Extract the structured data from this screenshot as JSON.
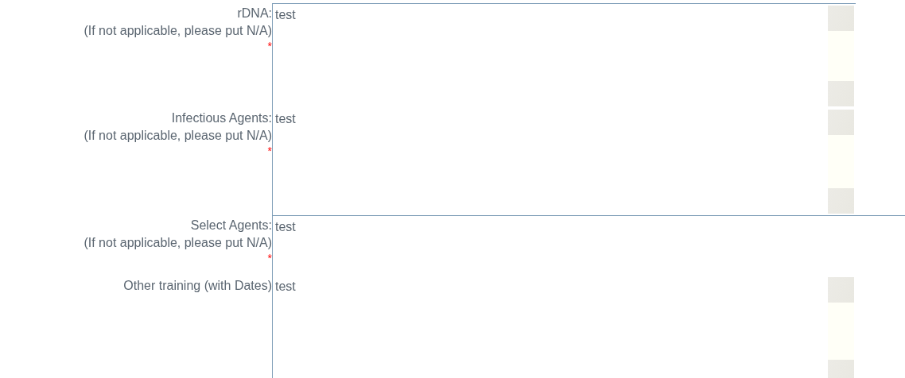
{
  "fields": [
    {
      "label": "rDNA:",
      "note": "(If not applicable, please put N/A)",
      "required_mark": "*",
      "value": "test",
      "scrollbar": true
    },
    {
      "label": "Infectious Agents:",
      "note": "(If not applicable, please put N/A)",
      "required_mark": "*",
      "value": "test",
      "scrollbar": true
    },
    {
      "label": "Select Agents:",
      "note": "(If not applicable, please put N/A)",
      "required_mark": "*",
      "value": "test",
      "scrollbar": false
    },
    {
      "label": "Other training (with Dates)",
      "value": "test",
      "scrollbar": true
    }
  ]
}
